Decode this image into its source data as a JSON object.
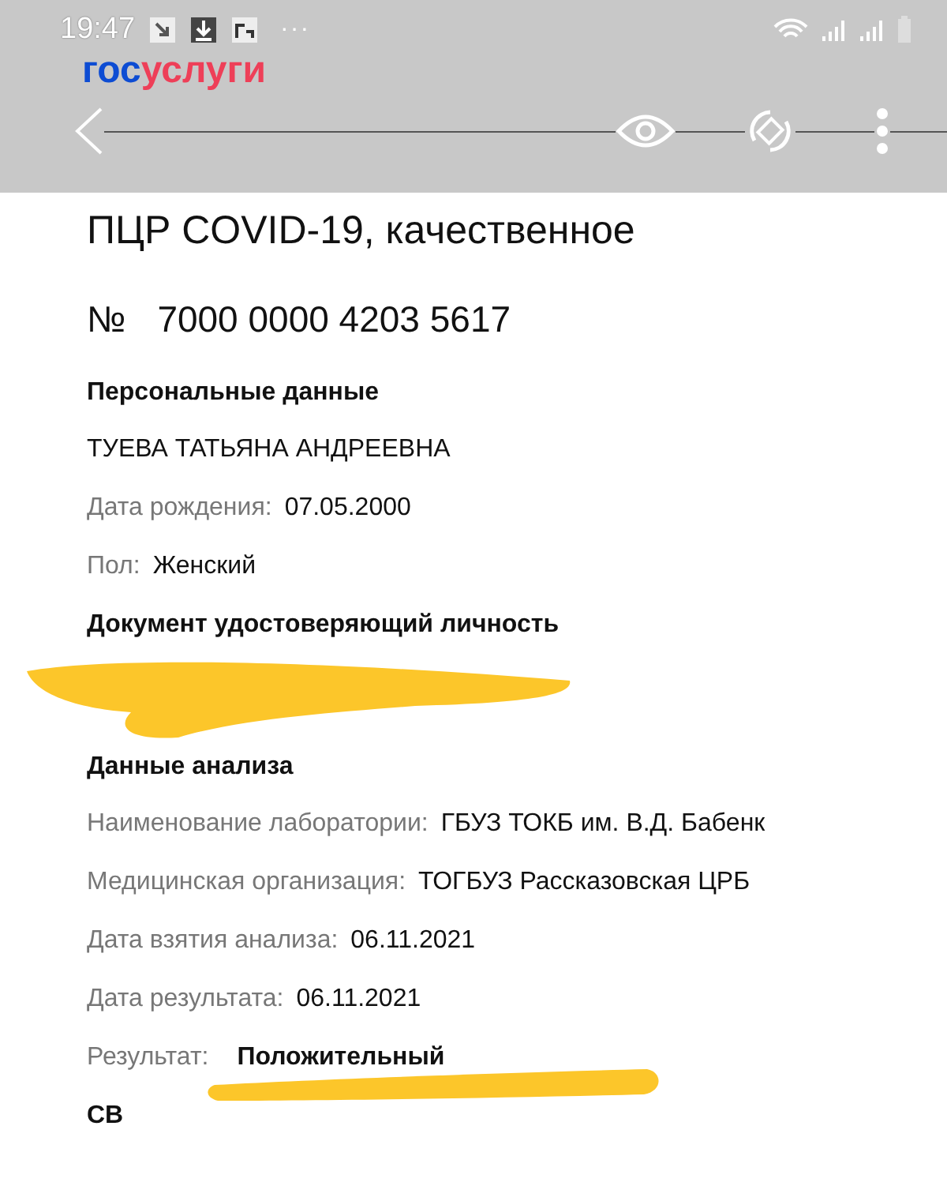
{
  "status_bar": {
    "time": "19:47",
    "more": "···"
  },
  "browser": {
    "logo_left": "гос",
    "logo_right": "услуги"
  },
  "document": {
    "title": "ПЦР COVID-19, качественное",
    "number_sign": "№",
    "number": "7000 0000 4203 5617"
  },
  "sections": [
    {
      "heading": "Персональные данные",
      "rows": [
        {
          "kind": "plain",
          "value": "ТУЕВА ТАТЬЯНА АНДРЕЕВНА"
        },
        {
          "kind": "pair",
          "label": "Дата рождения:",
          "value": "07.05.2000"
        },
        {
          "kind": "pair",
          "label": "Пол:",
          "value": "Женский"
        }
      ]
    },
    {
      "heading": "Документ удостоверяющий личность",
      "scribble": true
    },
    {
      "heading": "Данные анализа",
      "rows": [
        {
          "kind": "pair",
          "label": "Наименование лаборатории:",
          "value": "ГБУЗ ТОКБ им. В.Д. Бабенк"
        },
        {
          "kind": "pair",
          "label": "Медицинская организация:",
          "value": "ТОГБУЗ Рассказовская ЦРБ"
        },
        {
          "kind": "pair",
          "label": "Дата взятия анализа:",
          "value": "06.11.2021"
        },
        {
          "kind": "pair",
          "label": "Дата результата:",
          "value": "06.11.2021"
        },
        {
          "kind": "pair",
          "label": "Результат:",
          "value": "Положительный",
          "underlined": true
        }
      ]
    },
    {
      "heading": "СВ"
    }
  ]
}
